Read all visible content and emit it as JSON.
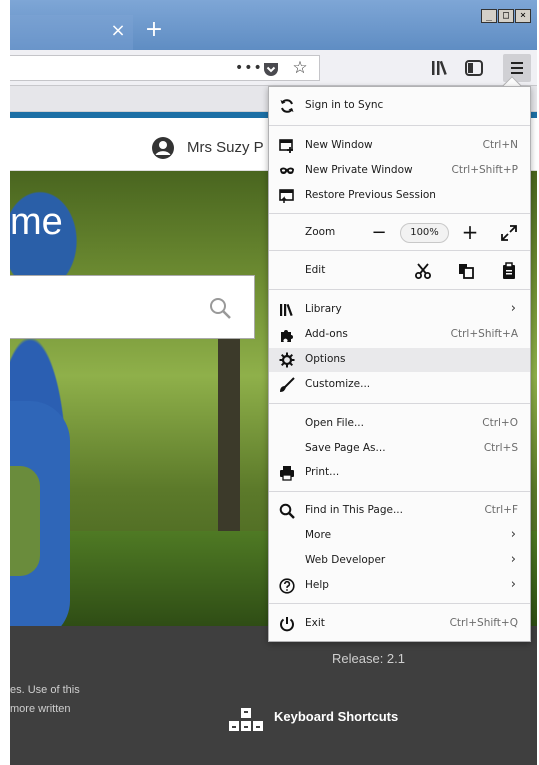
{
  "window": {
    "tab_close_glyph": "×",
    "new_tab_glyph": "+",
    "win_minimize": "_",
    "win_restore": "□",
    "win_close": "×"
  },
  "navbar": {
    "page_actions_glyph": "•••",
    "bookmark_glyph": "☆"
  },
  "page": {
    "user_name": "Mrs Suzy P",
    "hero_title": "me",
    "release": "Release: 2.1",
    "footer_line1": "es. Use of this",
    "footer_line2": " more written",
    "keyboard_shortcuts": "Keyboard Shortcuts"
  },
  "menu": {
    "sync": "Sign in to Sync",
    "new_window": "New Window",
    "new_window_sc": "Ctrl+N",
    "new_private": "New Private Window",
    "new_private_sc": "Ctrl+Shift+P",
    "restore": "Restore Previous Session",
    "zoom": "Zoom",
    "zoom_minus": "−",
    "zoom_value": "100%",
    "zoom_plus": "+",
    "edit": "Edit",
    "library": "Library",
    "addons": "Add-ons",
    "addons_sc": "Ctrl+Shift+A",
    "options": "Options",
    "customize": "Customize...",
    "open_file": "Open File...",
    "open_file_sc": "Ctrl+O",
    "save_page": "Save Page As...",
    "save_page_sc": "Ctrl+S",
    "print": "Print...",
    "find": "Find in This Page...",
    "find_sc": "Ctrl+F",
    "more": "More",
    "web_dev": "Web Developer",
    "help": "Help",
    "exit": "Exit",
    "exit_sc": "Ctrl+Shift+Q",
    "chevron": "›"
  }
}
